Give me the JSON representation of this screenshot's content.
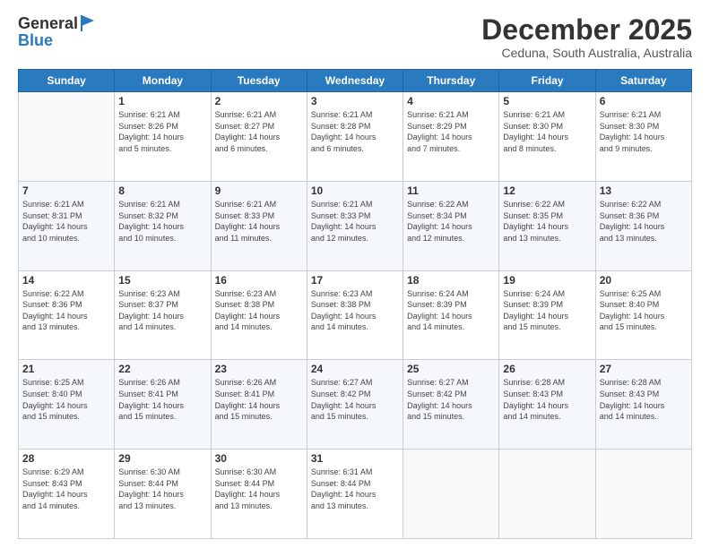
{
  "header": {
    "logo": {
      "line1": "General",
      "line2": "Blue"
    },
    "title": "December 2025",
    "subtitle": "Ceduna, South Australia, Australia"
  },
  "weekdays": [
    "Sunday",
    "Monday",
    "Tuesday",
    "Wednesday",
    "Thursday",
    "Friday",
    "Saturday"
  ],
  "weeks": [
    [
      {
        "day": "",
        "info": ""
      },
      {
        "day": "1",
        "info": "Sunrise: 6:21 AM\nSunset: 8:26 PM\nDaylight: 14 hours\nand 5 minutes."
      },
      {
        "day": "2",
        "info": "Sunrise: 6:21 AM\nSunset: 8:27 PM\nDaylight: 14 hours\nand 6 minutes."
      },
      {
        "day": "3",
        "info": "Sunrise: 6:21 AM\nSunset: 8:28 PM\nDaylight: 14 hours\nand 6 minutes."
      },
      {
        "day": "4",
        "info": "Sunrise: 6:21 AM\nSunset: 8:29 PM\nDaylight: 14 hours\nand 7 minutes."
      },
      {
        "day": "5",
        "info": "Sunrise: 6:21 AM\nSunset: 8:30 PM\nDaylight: 14 hours\nand 8 minutes."
      },
      {
        "day": "6",
        "info": "Sunrise: 6:21 AM\nSunset: 8:30 PM\nDaylight: 14 hours\nand 9 minutes."
      }
    ],
    [
      {
        "day": "7",
        "info": "Sunrise: 6:21 AM\nSunset: 8:31 PM\nDaylight: 14 hours\nand 10 minutes."
      },
      {
        "day": "8",
        "info": "Sunrise: 6:21 AM\nSunset: 8:32 PM\nDaylight: 14 hours\nand 10 minutes."
      },
      {
        "day": "9",
        "info": "Sunrise: 6:21 AM\nSunset: 8:33 PM\nDaylight: 14 hours\nand 11 minutes."
      },
      {
        "day": "10",
        "info": "Sunrise: 6:21 AM\nSunset: 8:33 PM\nDaylight: 14 hours\nand 12 minutes."
      },
      {
        "day": "11",
        "info": "Sunrise: 6:22 AM\nSunset: 8:34 PM\nDaylight: 14 hours\nand 12 minutes."
      },
      {
        "day": "12",
        "info": "Sunrise: 6:22 AM\nSunset: 8:35 PM\nDaylight: 14 hours\nand 13 minutes."
      },
      {
        "day": "13",
        "info": "Sunrise: 6:22 AM\nSunset: 8:36 PM\nDaylight: 14 hours\nand 13 minutes."
      }
    ],
    [
      {
        "day": "14",
        "info": "Sunrise: 6:22 AM\nSunset: 8:36 PM\nDaylight: 14 hours\nand 13 minutes."
      },
      {
        "day": "15",
        "info": "Sunrise: 6:23 AM\nSunset: 8:37 PM\nDaylight: 14 hours\nand 14 minutes."
      },
      {
        "day": "16",
        "info": "Sunrise: 6:23 AM\nSunset: 8:38 PM\nDaylight: 14 hours\nand 14 minutes."
      },
      {
        "day": "17",
        "info": "Sunrise: 6:23 AM\nSunset: 8:38 PM\nDaylight: 14 hours\nand 14 minutes."
      },
      {
        "day": "18",
        "info": "Sunrise: 6:24 AM\nSunset: 8:39 PM\nDaylight: 14 hours\nand 14 minutes."
      },
      {
        "day": "19",
        "info": "Sunrise: 6:24 AM\nSunset: 8:39 PM\nDaylight: 14 hours\nand 15 minutes."
      },
      {
        "day": "20",
        "info": "Sunrise: 6:25 AM\nSunset: 8:40 PM\nDaylight: 14 hours\nand 15 minutes."
      }
    ],
    [
      {
        "day": "21",
        "info": "Sunrise: 6:25 AM\nSunset: 8:40 PM\nDaylight: 14 hours\nand 15 minutes."
      },
      {
        "day": "22",
        "info": "Sunrise: 6:26 AM\nSunset: 8:41 PM\nDaylight: 14 hours\nand 15 minutes."
      },
      {
        "day": "23",
        "info": "Sunrise: 6:26 AM\nSunset: 8:41 PM\nDaylight: 14 hours\nand 15 minutes."
      },
      {
        "day": "24",
        "info": "Sunrise: 6:27 AM\nSunset: 8:42 PM\nDaylight: 14 hours\nand 15 minutes."
      },
      {
        "day": "25",
        "info": "Sunrise: 6:27 AM\nSunset: 8:42 PM\nDaylight: 14 hours\nand 15 minutes."
      },
      {
        "day": "26",
        "info": "Sunrise: 6:28 AM\nSunset: 8:43 PM\nDaylight: 14 hours\nand 14 minutes."
      },
      {
        "day": "27",
        "info": "Sunrise: 6:28 AM\nSunset: 8:43 PM\nDaylight: 14 hours\nand 14 minutes."
      }
    ],
    [
      {
        "day": "28",
        "info": "Sunrise: 6:29 AM\nSunset: 8:43 PM\nDaylight: 14 hours\nand 14 minutes."
      },
      {
        "day": "29",
        "info": "Sunrise: 6:30 AM\nSunset: 8:44 PM\nDaylight: 14 hours\nand 13 minutes."
      },
      {
        "day": "30",
        "info": "Sunrise: 6:30 AM\nSunset: 8:44 PM\nDaylight: 14 hours\nand 13 minutes."
      },
      {
        "day": "31",
        "info": "Sunrise: 6:31 AM\nSunset: 8:44 PM\nDaylight: 14 hours\nand 13 minutes."
      },
      {
        "day": "",
        "info": ""
      },
      {
        "day": "",
        "info": ""
      },
      {
        "day": "",
        "info": ""
      }
    ]
  ]
}
